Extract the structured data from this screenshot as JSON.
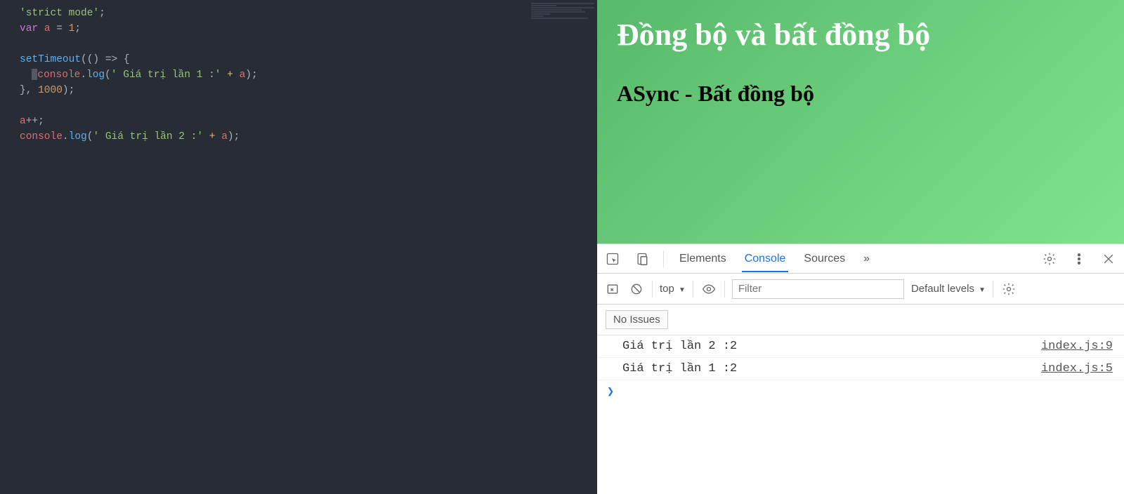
{
  "code": {
    "l1": "'strict mode'",
    "l2a": "var",
    "l2b": "a",
    "l2c": "=",
    "l2d": "1",
    "l2e": ";",
    "l4a": "setTimeout",
    "l4b": "(() => {",
    "l5a": "console",
    "l5b": ".",
    "l5c": "log",
    "l5d": "(",
    "l5e": "' Giá trị lần 1 :'",
    "l5f": " + ",
    "l5g": "a",
    "l5h": ");",
    "l6a": "}, ",
    "l6b": "1000",
    "l6c": ");",
    "l8a": "a",
    "l8b": "++;",
    "l9a": "console",
    "l9b": ".",
    "l9c": "log",
    "l9d": "(",
    "l9e": "' Giá trị lần 2 :'",
    "l9f": " + ",
    "l9g": "a",
    "l9h": ");"
  },
  "preview": {
    "title": "Đồng bộ và bất đồng bộ",
    "subtitle": "ASync - Bất đồng bộ"
  },
  "devtools": {
    "tabs": {
      "elements": "Elements",
      "console": "Console",
      "sources": "Sources",
      "more": "»"
    },
    "toolbar": {
      "top": "top",
      "filter_placeholder": "Filter",
      "levels": "Default levels"
    },
    "issues": "No Issues",
    "logs": [
      {
        "msg": " Giá trị lần 2 :2",
        "src": "index.js:9"
      },
      {
        "msg": " Giá trị lần 1 :2",
        "src": "index.js:5"
      }
    ],
    "prompt": "❯"
  }
}
